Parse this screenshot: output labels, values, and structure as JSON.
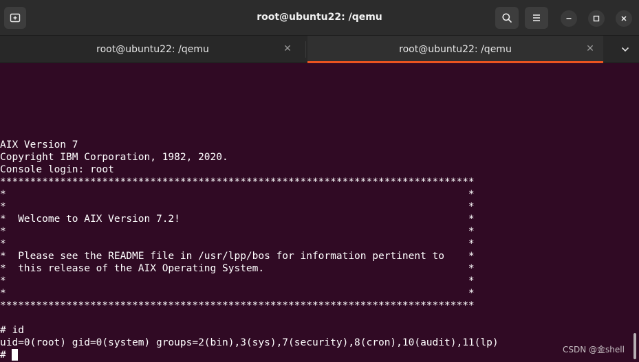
{
  "window": {
    "title": "root@ubuntu22: /qemu"
  },
  "header": {
    "icons": [
      "new-tab-icon",
      "search-icon",
      "hamburger-menu-icon",
      "minimize-icon",
      "maximize-icon",
      "close-icon"
    ]
  },
  "tabs": [
    {
      "label": "root@ubuntu22: /qemu",
      "active": false
    },
    {
      "label": "root@ubuntu22: /qemu",
      "active": true
    }
  ],
  "colors": {
    "terminal_background": "#300a24",
    "active_tab_indicator": "#e95420",
    "text": "#ffffff"
  },
  "terminal": {
    "lines": [
      "AIX Version 7",
      "Copyright IBM Corporation, 1982, 2020.",
      "Console login: root",
      "*******************************************************************************",
      "*                                                                             *",
      "*                                                                             *",
      "*  Welcome to AIX Version 7.2!                                                *",
      "*                                                                             *",
      "*                                                                             *",
      "*  Please see the README file in /usr/lpp/bos for information pertinent to    *",
      "*  this release of the AIX Operating System.                                  *",
      "*                                                                             *",
      "*                                                                             *",
      "*******************************************************************************",
      "",
      "# id",
      "uid=0(root) gid=0(system) groups=2(bin),3(sys),7(security),8(cron),10(audit),11(lp)",
      "#"
    ]
  },
  "watermark": "CSDN @金shell"
}
